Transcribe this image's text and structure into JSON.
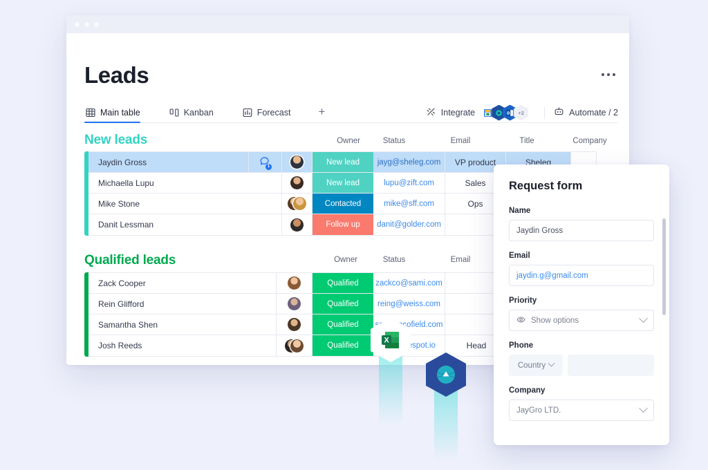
{
  "window": {
    "title_dots": 3
  },
  "header": {
    "title": "Leads",
    "more_menu": "more-options"
  },
  "tabs": [
    {
      "label": "Main table",
      "icon": "grid-icon",
      "active": true
    },
    {
      "label": "Kanban",
      "icon": "kanban-icon",
      "active": false
    },
    {
      "label": "Forecast",
      "icon": "chart-icon",
      "active": false
    }
  ],
  "tab_add_label": "+",
  "toolbar": {
    "integrate_label": "Integrate",
    "integrate_icon": "integrate-icon",
    "apps_badge": "+2",
    "apps": [
      "google-drive-app-icon",
      "teams-app-icon",
      "outlook-app-icon"
    ],
    "automate_label": "Automate / 2",
    "automate_icon": "robot-icon"
  },
  "groups": [
    {
      "name": "New leads",
      "color": "#33d3c3",
      "columns": [
        "Owner",
        "Status",
        "Email",
        "Title",
        "Company"
      ],
      "add_column_label": "+",
      "rows": [
        {
          "name": "Jaydin Gross",
          "status": "New lead",
          "status_class": "st-new",
          "email": "jayg@sheleg.com",
          "title": "VP product",
          "company": "Sheleg",
          "selected": true,
          "chat": "1"
        },
        {
          "name": "Michaella Lupu",
          "status": "New lead",
          "status_class": "st-new",
          "email": "lupu@zift.com",
          "title": "Sales",
          "company": "",
          "selected": false
        },
        {
          "name": "Mike Stone",
          "status": "Contacted",
          "status_class": "st-contacted",
          "email": "mike@sff.com",
          "title": "Ops",
          "company": "",
          "selected": false
        },
        {
          "name": "Danit Lessman",
          "status": "Follow up",
          "status_class": "st-follow",
          "email": "danit@golder.com",
          "title": "",
          "company": "",
          "selected": false
        }
      ]
    },
    {
      "name": "Qualified leads",
      "color": "#00a94f",
      "columns": [
        "Owner",
        "Status",
        "Email"
      ],
      "rows": [
        {
          "name": "Zack Cooper",
          "status": "Qualified",
          "status_class": "st-qualified",
          "email": "zackco@sami.com",
          "title": "",
          "selected": false
        },
        {
          "name": "Rein Glifford",
          "status": "Qualified",
          "status_class": "st-qualified",
          "email": "reing@weiss.com",
          "title": "",
          "selected": false
        },
        {
          "name": "Samantha Shen",
          "status": "Qualified",
          "status_class": "st-qualified",
          "email": "sam@ecofield.com",
          "title": "",
          "selected": false
        },
        {
          "name": "Josh Reeds",
          "status": "Qualified",
          "status_class": "st-qualified",
          "email": "h@drivespot.io",
          "title": "Head",
          "selected": false
        }
      ]
    }
  ],
  "floating": {
    "excel": "excel-app-icon",
    "globe": "globe-app-icon"
  },
  "form": {
    "title": "Request form",
    "name_label": "Name",
    "name_value": "Jaydin Gross",
    "email_label": "Email",
    "email_value": "jaydin.g@gmail.com",
    "priority_label": "Priority",
    "priority_value": "Show options",
    "priority_icon": "eye-icon",
    "phone_label": "Phone",
    "country_value": "Country",
    "phone_value": "",
    "company_label": "Company",
    "company_value": "JayGro LTD."
  },
  "colors": {
    "page_bg": "#eef0fb",
    "new_lead": "#4fd2c2",
    "contacted": "#0086c0",
    "follow_up": "#fa7a6e",
    "qualified": "#00ca72",
    "selected_row": "#bfdcf8",
    "link": "#3b8aea",
    "tab_active": "#1d73f0"
  }
}
